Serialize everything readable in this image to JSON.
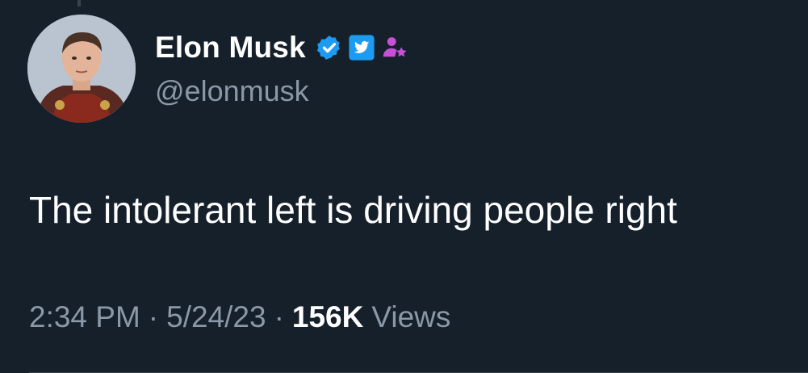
{
  "author": {
    "display_name": "Elon Musk",
    "handle": "@elonmusk",
    "avatar": "profile-photo",
    "badges": [
      "verified-badge-icon",
      "twitter-bird-badge-icon",
      "affiliate-person-star-icon"
    ]
  },
  "tweet": {
    "text": "The intolerant left is driving people right"
  },
  "meta": {
    "time": "2:34 PM",
    "separator": "·",
    "date": "5/24/23",
    "views_count": "156K",
    "views_label": "Views"
  },
  "colors": {
    "background": "#15202b",
    "text_primary": "#ffffff",
    "text_secondary": "#8b98a5",
    "verified_blue": "#1d9bf0",
    "affiliate_purple": "#c84fd8",
    "divider": "#38444d"
  }
}
